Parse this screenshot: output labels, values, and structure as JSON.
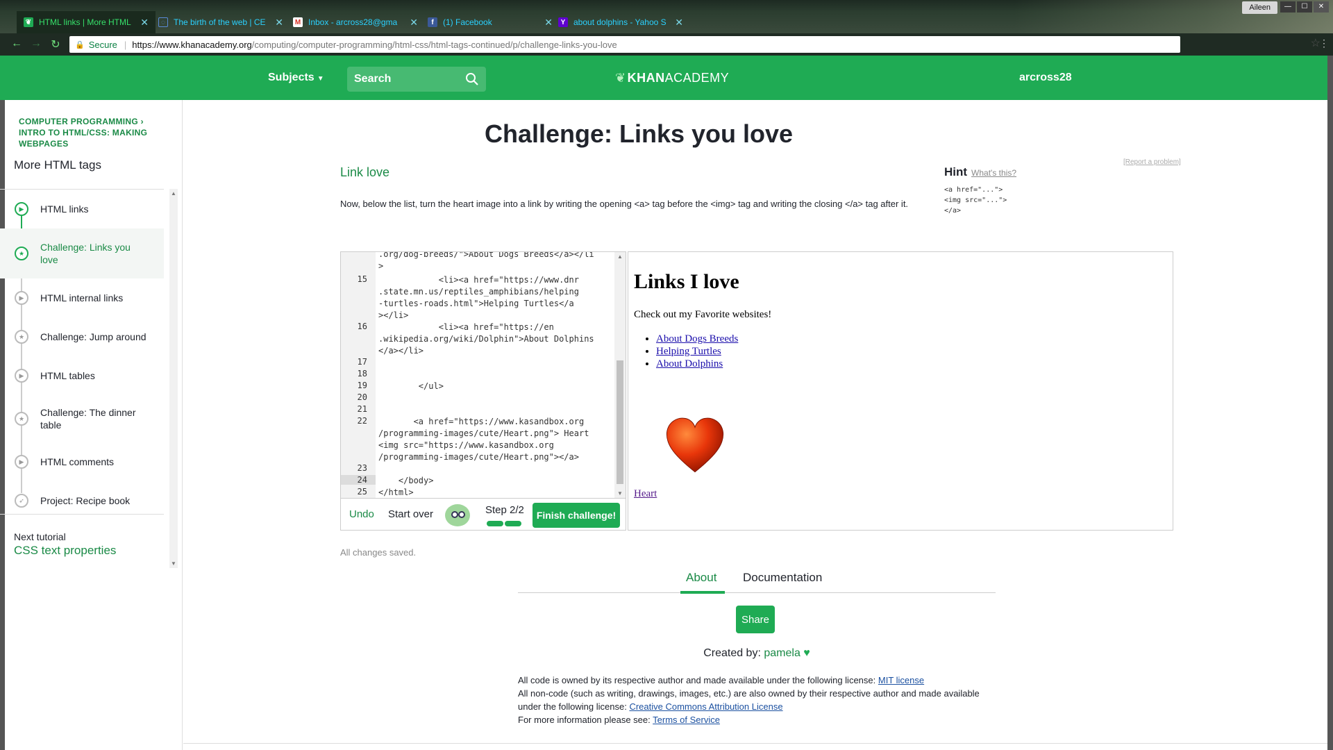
{
  "browser": {
    "tabs": [
      {
        "title": "HTML links | More HTML",
        "favicon": "khan-leaf-icon",
        "active": true
      },
      {
        "title": "The birth of the web | CE",
        "favicon": "cern-icon",
        "active": false
      },
      {
        "title": "Inbox - arcross28@gma",
        "favicon": "gmail-icon",
        "active": false
      },
      {
        "title": "(1) Facebook",
        "favicon": "facebook-icon",
        "active": false
      },
      {
        "title": "about dolphins - Yahoo S",
        "favicon": "yahoo-icon",
        "active": false
      }
    ],
    "profile": "Aileen",
    "secure_label": "Secure",
    "url_host": "https://www.khanacademy.org",
    "url_path": "/computing/computer-programming/html-css/html-tags-continued/p/challenge-links-you-love"
  },
  "header": {
    "subjects": "Subjects",
    "search_placeholder": "Search",
    "brand_bold": "KHAN",
    "brand_light": "ACADEMY",
    "username": "arcross28"
  },
  "sidebar": {
    "crumb1": "COMPUTER PROGRAMMING  ›",
    "crumb2": "INTRO TO HTML/CSS: MAKING",
    "crumb3": "WEBPAGES",
    "title": "More HTML tags",
    "items": [
      {
        "label": "HTML links",
        "icon": "play-icon",
        "state": "done"
      },
      {
        "label": "Challenge: Links you love",
        "icon": "star-icon",
        "state": "active"
      },
      {
        "label": "HTML internal links",
        "icon": "play-icon",
        "state": "todo"
      },
      {
        "label": "Challenge: Jump around",
        "icon": "star-icon",
        "state": "todo"
      },
      {
        "label": "HTML tables",
        "icon": "play-icon",
        "state": "todo"
      },
      {
        "label": "Challenge: The dinner table",
        "icon": "star-icon",
        "state": "todo"
      },
      {
        "label": "HTML comments",
        "icon": "play-icon",
        "state": "todo"
      },
      {
        "label": "Project: Recipe book",
        "icon": "rocket-icon",
        "state": "todo"
      }
    ],
    "next_label": "Next tutorial",
    "next_link": "CSS text properties"
  },
  "main": {
    "title": "Challenge: Links you love",
    "step_title": "Link love",
    "report": "[Report a problem]",
    "hint_label": "Hint",
    "hint_what": "What's this?",
    "hint_code": "<a href=\"...\">\n<img src=\"...\">\n</a>",
    "instructions": "Now, below the list, turn the heart image into a link by writing the opening <a> tag before the <img> tag and writing the closing </a> tag after it.",
    "saved": "All changes saved."
  },
  "editor": {
    "line_numbers": [
      "15",
      "16",
      "17",
      "18",
      "19",
      "20",
      "21",
      "22",
      "23",
      "24",
      "25"
    ],
    "current_line": "24",
    "code_lines": [
      ".org/dog-breeds/\">About Dogs Breeds</a></li",
      ">",
      "            <li><a href=\"https://www.dnr",
      ".state.mn.us/reptiles_amphibians/helping",
      "-turtles-roads.html\">Helping Turtles</a",
      "></li>",
      "            <li><a href=\"https://en",
      ".wikipedia.org/wiki/Dolphin\">About Dolphins",
      "</a></li>",
      "",
      "",
      "        </ul>",
      "",
      "",
      "       <a href=\"https://www.kasandbox.org",
      "/programming-images/cute/Heart.png\"> Heart",
      "<img src=\"https://www.kasandbox.org",
      "/programming-images/cute/Heart.png\"></a>",
      "",
      "    </body>",
      "</html>"
    ],
    "undo": "Undo",
    "start_over": "Start over",
    "step": "Step 2/2",
    "steps_complete": 2,
    "steps_total": 2,
    "finish": "Finish challenge!"
  },
  "output": {
    "heading": "Links I love",
    "paragraph": "Check out my Favorite websites!",
    "links": [
      "About Dogs Breeds",
      "Helping Turtles",
      "About Dolphins"
    ],
    "heart_link": "Heart"
  },
  "footer": {
    "tab_about": "About",
    "tab_docs": "Documentation",
    "share": "Share",
    "created_by": "Created by:",
    "author": "pamela",
    "license_1": "All code is owned by its respective author and made available under the following license:",
    "license_1_link": "MIT license",
    "license_2": "All non-code (such as writing, drawings, images, etc.) are also owned by their respective author and made available under the following license:",
    "license_2_link": "Creative Commons Attribution License",
    "license_3": "For more information please see:",
    "license_3_link": "Terms of Service"
  },
  "colors": {
    "ka_green": "#1fab54",
    "ka_dark_green": "#1a8a46",
    "tab_text": "#2bd1ff",
    "heart_red": "#e8360a"
  }
}
